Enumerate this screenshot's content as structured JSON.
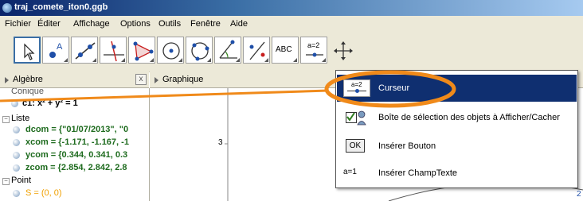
{
  "window": {
    "title": "traj_comete_iton0.ggb"
  },
  "menu": [
    "Fichier",
    "Éditer",
    "Affichage",
    "Options",
    "Outils",
    "Fenêtre",
    "Aide"
  ],
  "toolbar": {
    "slider_tool_label": "a=2",
    "text_tool_label": "ABC",
    "tools": [
      "move-tool",
      "point-tool",
      "line-tool",
      "perpendicular-tool",
      "polygon-tool",
      "circle-tool",
      "conic-tool",
      "angle-tool",
      "reflect-tool",
      "text-tool",
      "slider-tool",
      "move-graphics-tool"
    ]
  },
  "algebra": {
    "title": "Algèbre",
    "close": "x",
    "items": [
      {
        "kind": "header",
        "text": "Conique",
        "partial": true
      },
      {
        "kind": "item",
        "text": "c1: x² + y² = 1"
      },
      {
        "kind": "header",
        "text": "Liste"
      },
      {
        "kind": "item",
        "text": "dcom = {\"01/07/2013\", \"0"
      },
      {
        "kind": "item",
        "text": "xcom = {-1.171, -1.167, -1"
      },
      {
        "kind": "item",
        "text": "ycom = {0.344, 0.341, 0.3"
      },
      {
        "kind": "item",
        "text": "zcom = {2.854, 2.842, 2.8"
      },
      {
        "kind": "header",
        "text": "Point"
      },
      {
        "kind": "item",
        "text": "S = (0, 0)",
        "partial": true
      }
    ]
  },
  "graphics": {
    "title": "Graphique",
    "y_tick_label": "3",
    "corner_label": "2"
  },
  "popup": {
    "items": [
      {
        "label": "Curseur",
        "icon_text": "a=2",
        "highlighted": true
      },
      {
        "label": "Boîte de sélection des objets à Afficher/Cacher",
        "icon_text": ""
      },
      {
        "label": "Insérer Bouton",
        "icon_text": "OK"
      },
      {
        "label": "Insérer ChampTexte",
        "icon_text": "a=1"
      }
    ]
  },
  "colors": {
    "highlight_oval": "#f08a1a",
    "menu_highlight": "#0f2f70",
    "list_item_text": "#1e6b1e",
    "point_text": "#f0a000"
  }
}
